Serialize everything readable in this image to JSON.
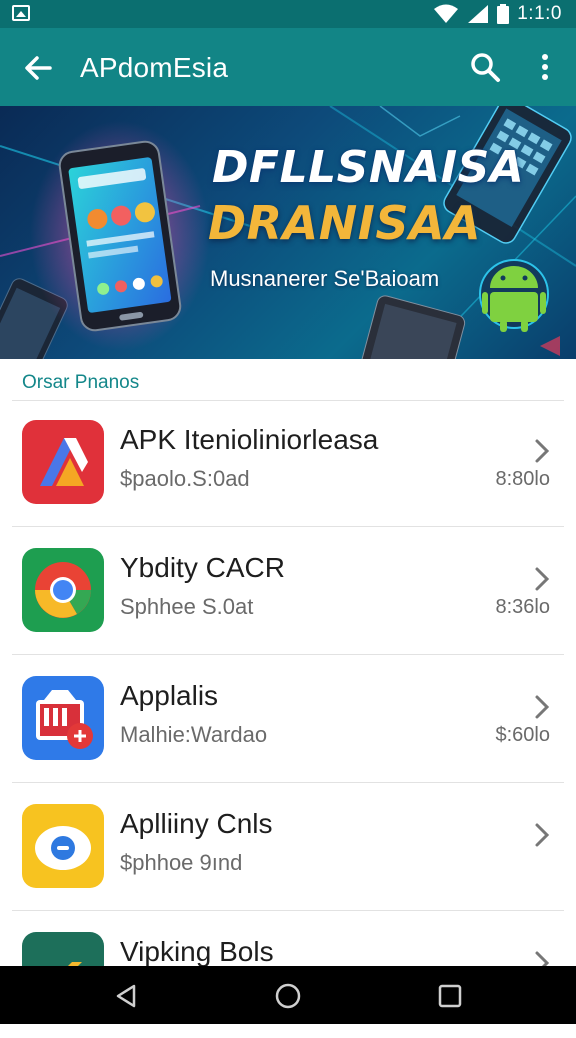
{
  "status_bar": {
    "time": "1:1:0",
    "icons": [
      "image-icon",
      "wifi-icon",
      "signal-icon",
      "battery-icon"
    ]
  },
  "app_bar": {
    "title": "APdomEsia",
    "back_icon": "arrow-back-icon",
    "search_icon": "search-icon",
    "more_icon": "more-vert-icon",
    "color": "#128586"
  },
  "banner": {
    "headline_1": "DFLLSNAISA",
    "headline_2": "DRANISAA",
    "subline": "Musnanerer Se'Baioam",
    "accent": "#f3b63a"
  },
  "section": {
    "header": "Orsar Pnanos"
  },
  "apps": [
    {
      "name": "APK Itenioliniorleasa",
      "meta": "$paolo.S:0ad",
      "size": "8:80lo",
      "icon": "apk-app-icon"
    },
    {
      "name": "Ybdity CACR",
      "meta": "Sphhee S.0at",
      "size": "8:36lo",
      "icon": "chrome-like-app-icon"
    },
    {
      "name": "Applalis",
      "meta": "Malhie:Wardao",
      "size": "$:60lo",
      "icon": "store-app-icon"
    },
    {
      "name": "Aplliiny Cnls",
      "meta": "$phhoe 9ınd",
      "size": "",
      "icon": "yellow-app-icon"
    },
    {
      "name": "Vipking Bols",
      "meta": "",
      "size": "",
      "icon": "green-app-icon"
    }
  ],
  "nav": {
    "back": "nav-back-icon",
    "home": "nav-home-icon",
    "recents": "nav-recents-icon"
  }
}
